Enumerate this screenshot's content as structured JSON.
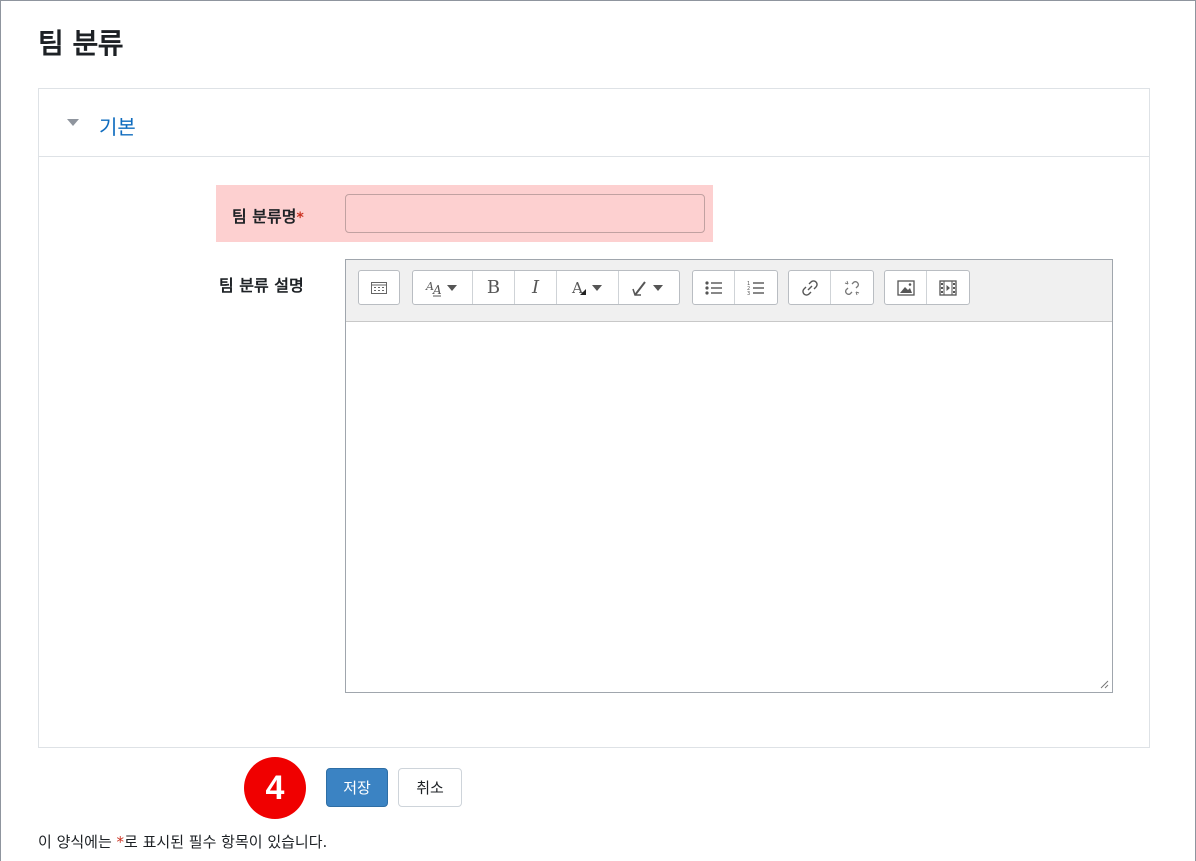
{
  "page": {
    "title": "팀 분류"
  },
  "section": {
    "legend": "기본"
  },
  "form": {
    "name_label": "팀 분류명",
    "required_star": "*",
    "name_value": "",
    "description_label": "팀 분류 설명"
  },
  "toolbar": {
    "groups": [
      [
        "toolbar-toggle-icon"
      ],
      [
        "font-style-icon",
        "bold-icon",
        "italic-icon",
        "text-color-icon",
        "highlight-icon"
      ],
      [
        "unordered-list-icon",
        "ordered-list-icon"
      ],
      [
        "link-icon",
        "unlink-icon"
      ],
      [
        "image-icon",
        "media-icon"
      ]
    ],
    "bold_glyph": "B",
    "italic_glyph": "I"
  },
  "buttons": {
    "save_label": "저장",
    "cancel_label": "취소"
  },
  "badge": {
    "step": "4"
  },
  "footer": {
    "note_before": "이 양식에는 ",
    "note_star": "*",
    "note_after": "로 표시된 필수 항목이 있습니다."
  },
  "colors": {
    "accent": "#0f6cbf",
    "required": "#ca3120",
    "error_bg": "#fdd0d0",
    "primary_button": "#3b83c3",
    "badge": "#f00000"
  }
}
